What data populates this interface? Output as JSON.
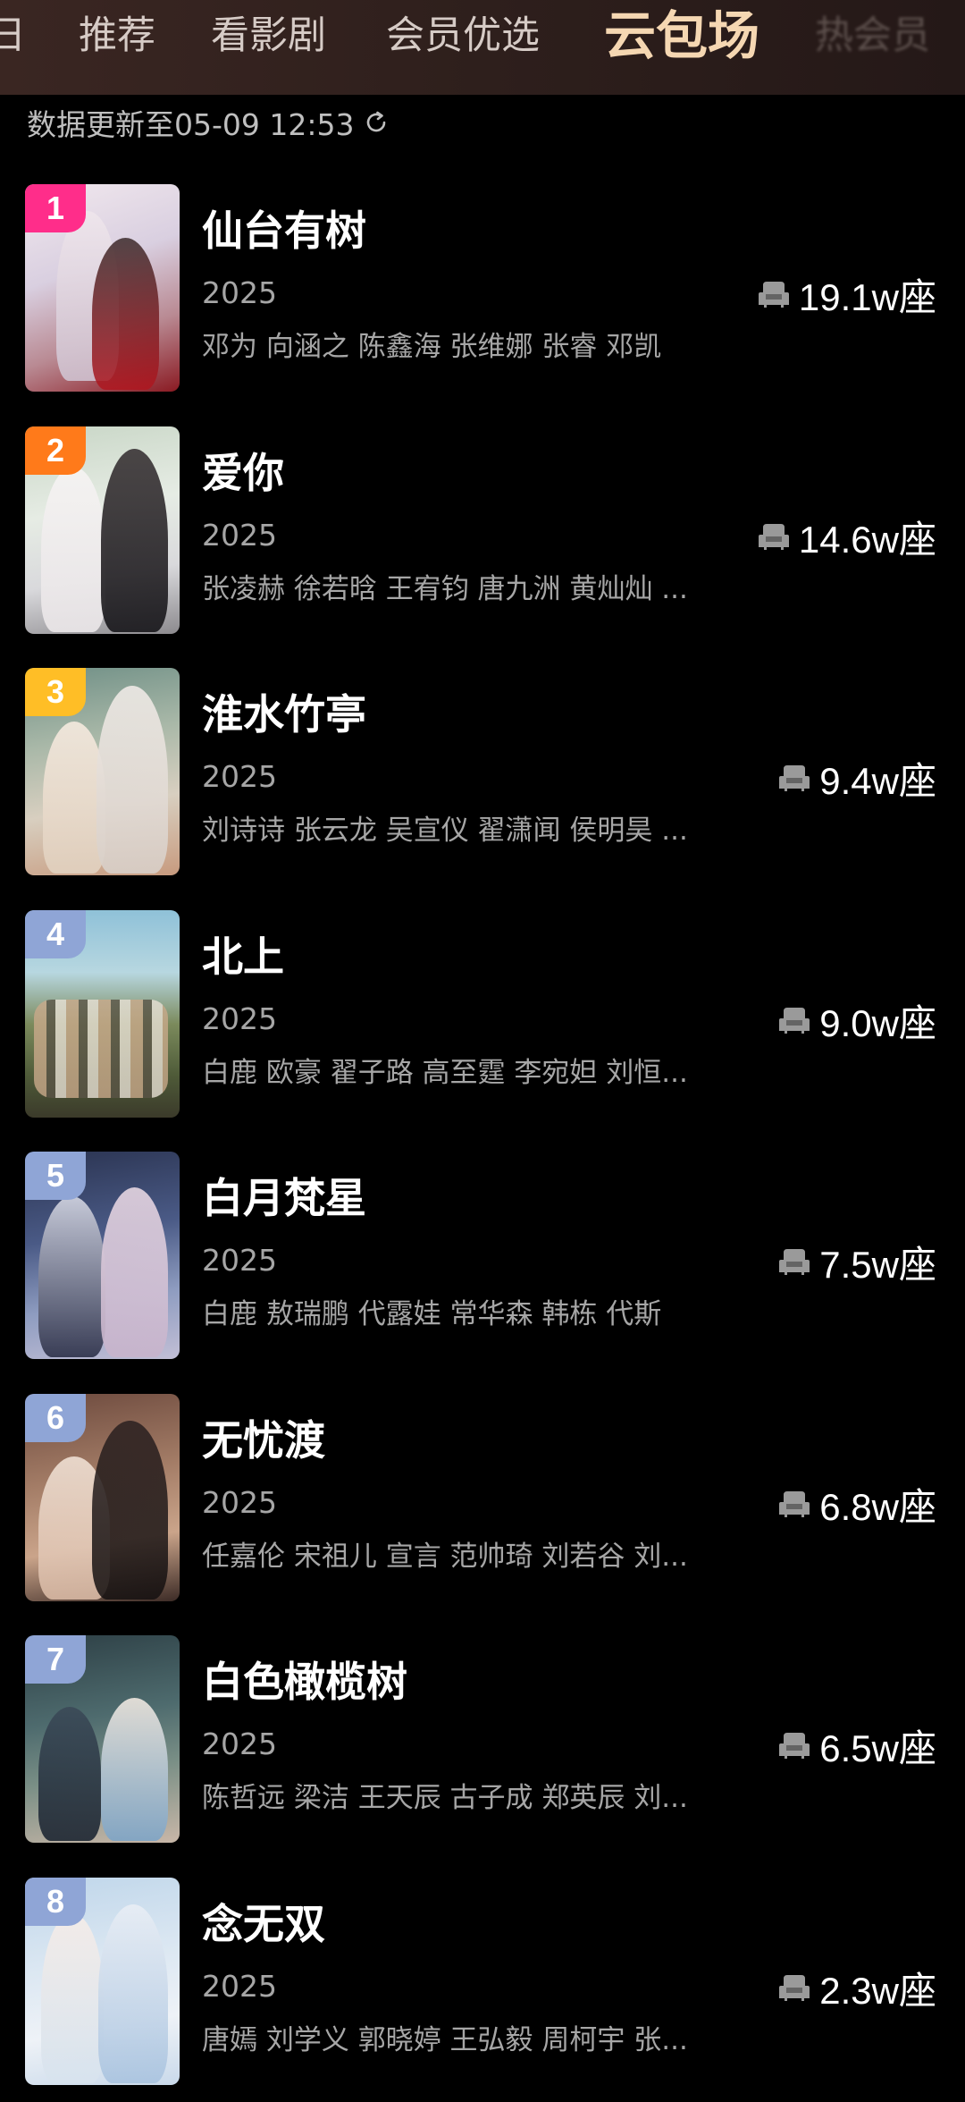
{
  "nav": {
    "tabs": [
      {
        "label": "日"
      },
      {
        "label": "推荐"
      },
      {
        "label": "看影剧"
      },
      {
        "label": "会员优选"
      },
      {
        "label": "云包场"
      },
      {
        "label": "热会员"
      }
    ],
    "active_index": 4
  },
  "update": {
    "text": "数据更新至05-09 12:53",
    "icon": "refresh-icon"
  },
  "colors": {
    "rank1": "#ff2d8a",
    "rank2": "#ff7a1a",
    "rank3": "#ffbe26",
    "rank_other": "#8fa5d6",
    "active_tab": "#f5d7b2"
  },
  "items": [
    {
      "rank": "1",
      "title": "仙台有树",
      "year": "2025",
      "cast": "邓为 向涵之 陈鑫海 张维娜 张睿 邓凯",
      "seats": "19.1w座"
    },
    {
      "rank": "2",
      "title": "爱你",
      "year": "2025",
      "cast": "张凌赫 徐若晗 王宥钧 唐九洲 黄灿灿 ...",
      "seats": "14.6w座"
    },
    {
      "rank": "3",
      "title": "淮水竹亭",
      "year": "2025",
      "cast": "刘诗诗 张云龙 吴宣仪 翟潇闻 侯明昊 ...",
      "seats": "9.4w座"
    },
    {
      "rank": "4",
      "title": "北上",
      "year": "2025",
      "cast": "白鹿 欧豪 翟子路 高至霆 李宛妲 刘恒...",
      "seats": "9.0w座"
    },
    {
      "rank": "5",
      "title": "白月梵星",
      "year": "2025",
      "cast": "白鹿 敖瑞鹏 代露娃 常华森 韩栋 代斯",
      "seats": "7.5w座"
    },
    {
      "rank": "6",
      "title": "无忧渡",
      "year": "2025",
      "cast": "任嘉伦 宋祖儿 宣言 范帅琦 刘若谷 刘...",
      "seats": "6.8w座"
    },
    {
      "rank": "7",
      "title": "白色橄榄树",
      "year": "2025",
      "cast": "陈哲远 梁洁 王天辰 古子成 郑英辰 刘...",
      "seats": "6.5w座"
    },
    {
      "rank": "8",
      "title": "念无双",
      "year": "2025",
      "cast": "唐嫣 刘学义 郭晓婷 王弘毅 周柯宇 张...",
      "seats": "2.3w座"
    }
  ]
}
